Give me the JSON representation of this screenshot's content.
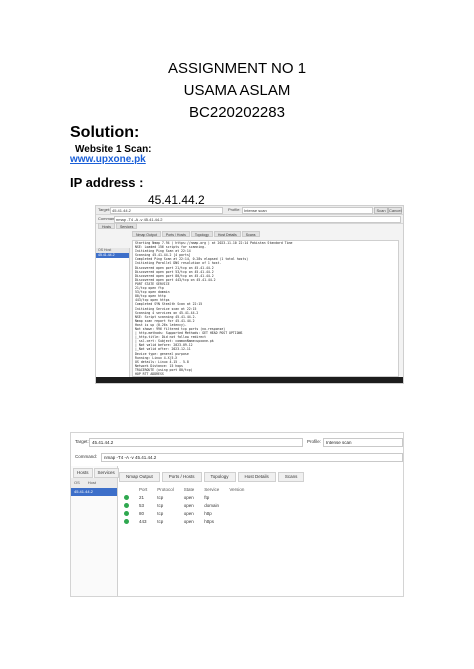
{
  "header": {
    "line1": "ASSIGNMENT NO 1",
    "line2": "USAMA ASLAM",
    "line3": "BC220202283"
  },
  "solution_label": "Solution:",
  "website_scan_label": "Website 1 Scan:",
  "website_link": "www.upxone.pk",
  "ip_label": "IP address :",
  "ip_value": "45.41.44.2",
  "shot1": {
    "target_label": "Target:",
    "target_value": "45.41.44.2",
    "profile_label": "Profile:",
    "profile_value": "Intense scan",
    "scan_button": "Scan",
    "cancel_button": "Cancel",
    "command_label": "Command:",
    "command_value": "nmap -T4 -A -v 45.41.44.2",
    "hosts_tab": "Hosts",
    "services_tab": "Services",
    "hosts_header": "OS  Host",
    "selected_host": "45.41.44.2",
    "tabs": [
      "Nmap Output",
      "Ports / Hosts",
      "Topology",
      "Host Details",
      "Scans"
    ],
    "output_lines": [
      "Starting Nmap 7.94 ( https://nmap.org ) at 2023-11-10 22:14 Pakistan Standard Time",
      "NSE: Loaded 156 scripts for scanning.",
      "Initiating Ping Scan at 22:14",
      "Scanning 45.41.44.2 [4 ports]",
      "Completed Ping Scan at 22:14, 0.28s elapsed (1 total hosts)",
      "Initiating Parallel DNS resolution of 1 host.",
      "Discovered open port 21/tcp on 45.41.44.2",
      "Discovered open port 53/tcp on 45.41.44.2",
      "Discovered open port 80/tcp on 45.41.44.2",
      "Discovered open port 443/tcp on 45.41.44.2",
      "PORT    STATE  SERVICE",
      "21/tcp  open   ftp",
      "53/tcp  open   domain",
      "80/tcp  open   http",
      "443/tcp open   https",
      "Completed SYN Stealth Scan at 22:15",
      "Initiating Service scan at 22:15",
      "Scanning 4 services on 45.41.44.2",
      "NSE: Script scanning 45.41.44.2.",
      "Nmap scan report for 45.41.44.2",
      "Host is up (0.26s latency).",
      "Not shown: 996 filtered tcp ports (no-response)",
      "| http-methods: Supported Methods: GET HEAD POST OPTIONS",
      "|_http-title: Did not follow redirect",
      "| ssl-cert: Subject: commonName=upxone.pk",
      "| Not valid before: 2023-09-12",
      "|_Not valid after:  2023-12-11",
      "Device type: general purpose",
      "Running: Linux 4.X|5.X",
      "OS details: Linux 4.15 - 5.8",
      "Network Distance: 15 hops",
      "TRACEROUTE (using port 80/tcp)",
      "HOP RTT       ADDRESS",
      "1   1.00 ms   192.168.1.1",
      "Read data files from: C:\\Program Files (x86)\\Nmap",
      "OS and Service detection performed. Please report any incorrect results.",
      "Nmap done: 1 IP address (1 host up) scanned in 62.45 seconds"
    ]
  },
  "shot2": {
    "target_label": "Target:",
    "target_value": "45.41.44.2",
    "profile_label": "Profile:",
    "profile_value": "Intense scan",
    "command_label": "Command:",
    "command_value": "nmap -T4 -A -v 45.41.44.2",
    "hosts_tab": "Hosts",
    "services_tab": "Services",
    "hosts_header_os": "OS",
    "hosts_header_host": "Host",
    "selected_host": "45.41.44.2",
    "tabs": [
      "Nmap Output",
      "Ports / Hosts",
      "Topology",
      "Host Details",
      "Scans"
    ],
    "table_headers": [
      "",
      "Port",
      "Protocol",
      "State",
      "Service",
      "Version"
    ],
    "rows": [
      {
        "port": "21",
        "protocol": "tcp",
        "state": "open",
        "service": "ftp"
      },
      {
        "port": "53",
        "protocol": "tcp",
        "state": "open",
        "service": "domain"
      },
      {
        "port": "80",
        "protocol": "tcp",
        "state": "open",
        "service": "http"
      },
      {
        "port": "443",
        "protocol": "tcp",
        "state": "open",
        "service": "https"
      }
    ]
  }
}
